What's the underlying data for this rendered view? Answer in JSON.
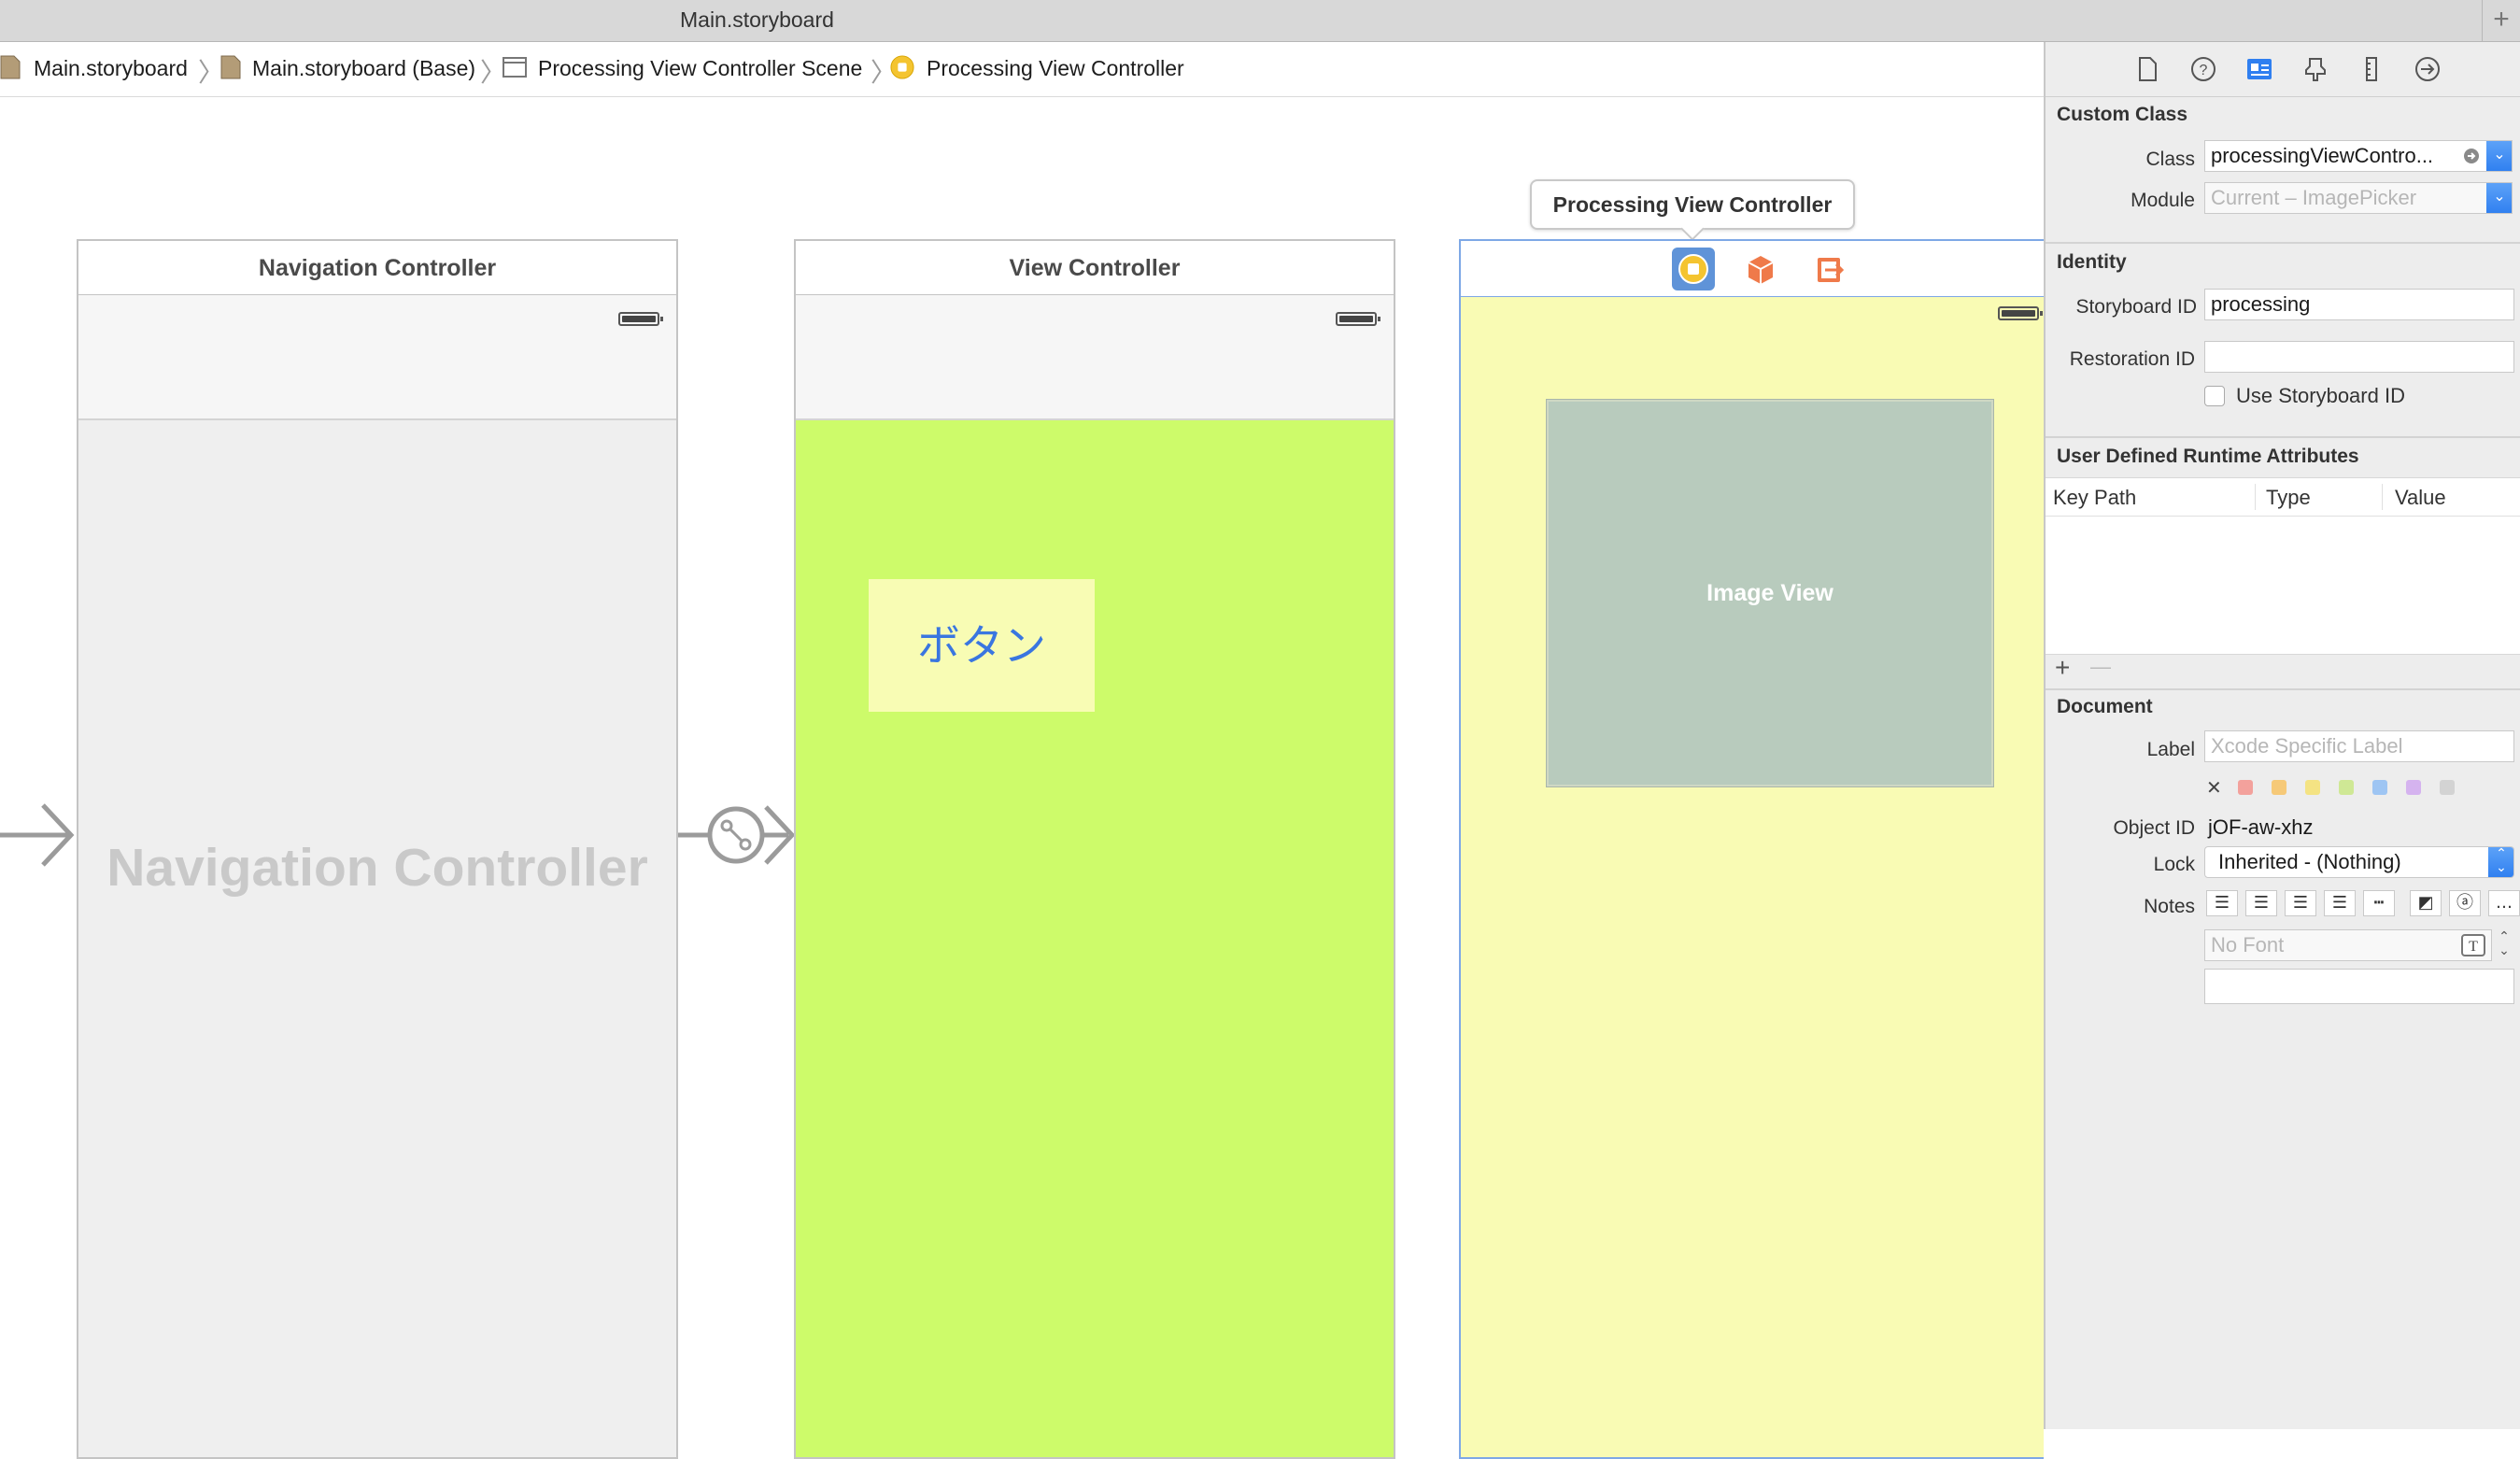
{
  "window": {
    "title": "Main.storyboard",
    "add_tab_label": "+"
  },
  "jumpbar": {
    "crumbs": [
      "Main.storyboard",
      "Main.storyboard (Base)",
      "Processing View Controller Scene",
      "Processing View Controller"
    ]
  },
  "canvas": {
    "nav_scene": {
      "title": "Navigation Controller",
      "placeholder": "Navigation Controller"
    },
    "vc_scene": {
      "title": "View Controller",
      "button_label": "ボタン"
    },
    "pvc_scene": {
      "tooltip": "Processing View Controller",
      "image_view_label": "Image View"
    },
    "colors": {
      "view_controller_bg": "#cdfb6a",
      "processing_bg": "#f9fbb4",
      "button_bg": "#f8fcb4",
      "image_view_bg": "#b8cbbd",
      "selection": "#7ea8e6"
    }
  },
  "inspector": {
    "tabs": [
      "file-icon",
      "help-icon",
      "identity-icon",
      "attributes-icon",
      "size-icon",
      "connections-icon"
    ],
    "custom_class": {
      "header": "Custom Class",
      "class_label": "Class",
      "class_value": "processingViewContro...",
      "module_label": "Module",
      "module_placeholder": "Current – ImagePicker"
    },
    "identity": {
      "header": "Identity",
      "storyboard_id_label": "Storyboard ID",
      "storyboard_id_value": "processing",
      "restoration_id_label": "Restoration ID",
      "restoration_id_value": "",
      "use_storyboard_id_label": "Use Storyboard ID"
    },
    "runtime_attributes": {
      "header": "User Defined Runtime Attributes",
      "columns": [
        "Key Path",
        "Type",
        "Value"
      ],
      "add_label": "+",
      "remove_label": "—"
    },
    "document": {
      "header": "Document",
      "label_label": "Label",
      "label_placeholder": "Xcode Specific Label",
      "clear_color_label": "✕",
      "swatch_colors": [
        "#f3a19c",
        "#f6c978",
        "#f4e383",
        "#cfe895",
        "#9ec5f3",
        "#d5b3ef",
        "#d3d3d3"
      ],
      "object_id_label": "Object ID",
      "object_id_value": "jOF-aw-xhz",
      "lock_label": "Lock",
      "lock_value": "Inherited - (Nothing)",
      "notes_label": "Notes",
      "font_placeholder": "No Font"
    }
  }
}
